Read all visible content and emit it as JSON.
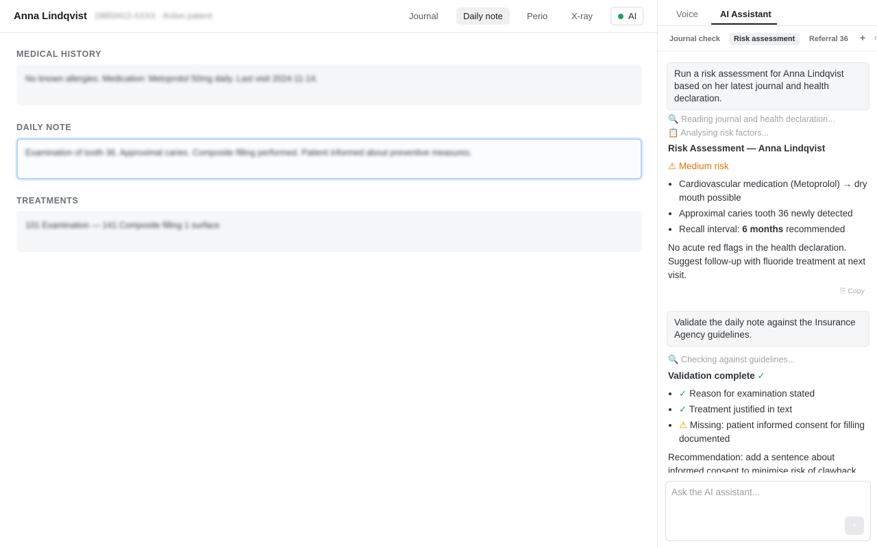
{
  "header": {
    "patient_name": "Anna Lindqvist",
    "patient_meta": "19850412-XXXX · Active patient",
    "nav": [
      {
        "label": "Journal",
        "active": false
      },
      {
        "label": "Daily note",
        "active": true
      },
      {
        "label": "Perio",
        "active": false
      },
      {
        "label": "X-ray",
        "active": false
      }
    ],
    "ai_toggle": {
      "label": "AI",
      "status_color": "#22a05a"
    }
  },
  "sections": {
    "medical_history": {
      "label": "MEDICAL HISTORY",
      "text": "No known allergies. Medication: Metoprolol 50mg daily. Last visit 2024-11-14."
    },
    "daily_note": {
      "label": "DAILY NOTE",
      "text": "Examination of tooth 36. Approximal caries. Composite filling performed. Patient informed about preventive measures."
    },
    "treatments": {
      "label": "TREATMENTS",
      "text": "101 Examination — 141 Composite filling 1 surface"
    }
  },
  "panel": {
    "tabs": [
      {
        "label": "Voice",
        "active": false
      },
      {
        "label": "AI Assistant",
        "active": true
      }
    ],
    "subtabs": [
      {
        "label": "Journal check",
        "active": false
      },
      {
        "label": "Risk assessment",
        "active": true
      },
      {
        "label": "Referral 36",
        "active": false
      }
    ],
    "add_label": "+",
    "more_label": "‹",
    "conversation": {
      "q1": "Run a risk assessment for Anna Lindqvist based on her latest journal and health declaration.",
      "status1": "🔍 Reading journal and health declaration...",
      "status2": "📋 Analysing risk factors...",
      "r1_title": "Risk Assessment — Anna Lindqvist",
      "r1_risk_icon": "⚠",
      "r1_risk": "Medium risk",
      "r1_b1": "Cardiovascular medication (Metoprolol) → dry mouth possible",
      "r1_b2": "Approximal caries tooth 36 newly detected",
      "r1_b3_pre": "Recall interval: ",
      "r1_b3_bold": "6 months",
      "r1_b3_post": " recommended",
      "r1_para": "No acute red flags in the health declaration. Suggest follow-up with fluoride treatment at next visit.",
      "copy_label": "⎘ Copy",
      "q2": "Validate the daily note against the Insurance Agency guidelines.",
      "status3": "🔍 Checking against guidelines...",
      "r2_title": "Validation complete",
      "r2_title_icon": "✓",
      "r2_items": [
        {
          "icon": "✓",
          "text": "Reason for examination stated"
        },
        {
          "icon": "✓",
          "text": "Treatment justified in text"
        },
        {
          "icon": "⚠",
          "text": "Missing: patient informed consent for filling documented"
        }
      ],
      "r2_para": "Recommendation: add a sentence about informed consent to minimise risk of clawback."
    },
    "input": {
      "placeholder": "Ask the AI assistant...",
      "send_icon": "↑"
    }
  }
}
